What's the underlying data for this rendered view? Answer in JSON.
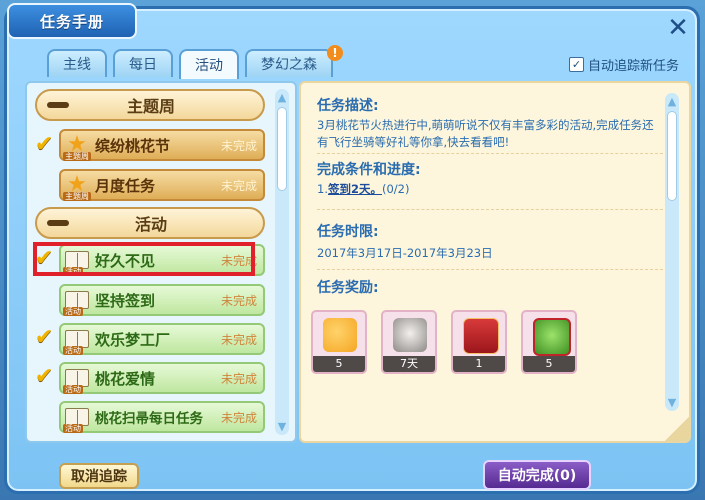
{
  "window": {
    "title": "任务手册",
    "close_icon": "close-icon"
  },
  "tabs": [
    {
      "label": "主线",
      "active": false
    },
    {
      "label": "每日",
      "active": false
    },
    {
      "label": "活动",
      "active": true
    },
    {
      "label": "梦幻之森",
      "active": false,
      "badge": "!"
    }
  ],
  "auto_track": {
    "label": "自动追踪新任务",
    "checked": true
  },
  "left": {
    "sections": [
      {
        "label": "主题周"
      },
      {
        "label": "活动"
      }
    ],
    "week_items": [
      {
        "name": "缤纷桃花节",
        "status": "未完成",
        "checked": true,
        "icon_tag": "主题周"
      },
      {
        "name": "月度任务",
        "status": "未完成",
        "checked": false,
        "icon_tag": "主题周"
      }
    ],
    "activity_items": [
      {
        "name": "好久不见",
        "status": "未完成",
        "checked": true,
        "icon_tag": "活动"
      },
      {
        "name": "坚持签到",
        "status": "未完成",
        "checked": false,
        "icon_tag": "活动"
      },
      {
        "name": "欢乐梦工厂",
        "status": "未完成",
        "checked": true,
        "icon_tag": "活动"
      },
      {
        "name": "桃花爱情",
        "status": "未完成",
        "checked": true,
        "icon_tag": "活动"
      },
      {
        "name": "桃花扫帚每日任务",
        "status": "未完成",
        "checked": false,
        "icon_tag": "活动"
      }
    ]
  },
  "detail": {
    "desc_title": "任务描述:",
    "desc_text": "3月桃花节火热进行中,萌萌听说不仅有丰富多彩的活动,完成任务还有飞行坐骑等好礼等你拿,快去看看吧!",
    "cond_title": "完成条件和进度:",
    "cond_prefix": "1.",
    "cond_link": "签到2天。",
    "cond_progress": "(0/2)",
    "time_title": "任务时限:",
    "time_text": "2017年3月17日-2017年3月23日",
    "reward_title": "任务奖励:",
    "rewards": [
      {
        "count": "5",
        "color": "#f5a623"
      },
      {
        "count": "7天",
        "color": "#c9c6c4"
      },
      {
        "count": "1",
        "color": "#c0242b"
      },
      {
        "count": "5",
        "color": "#6fbf3c"
      }
    ]
  },
  "buttons": {
    "cancel": "取消追踪",
    "auto_complete": "自动完成(0)"
  }
}
